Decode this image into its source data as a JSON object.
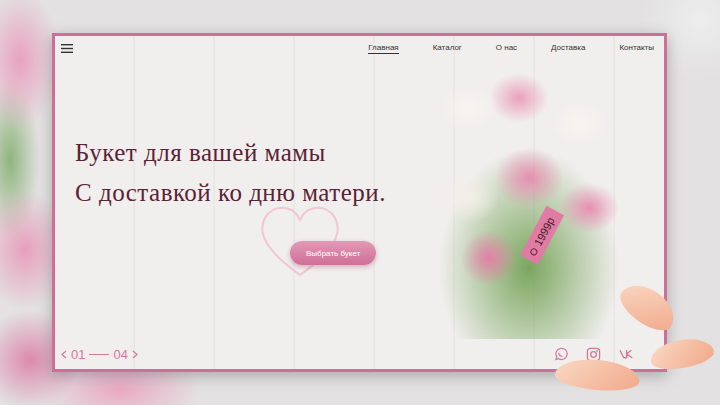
{
  "nav": [
    {
      "label": "Главная",
      "selected": true
    },
    {
      "label": "Каталог",
      "selected": false
    },
    {
      "label": "О нас",
      "selected": false
    },
    {
      "label": "Доставка",
      "selected": false
    },
    {
      "label": "Контакты",
      "selected": false
    }
  ],
  "hero": {
    "lines": [
      "Букет для вашей мамы",
      "С доставкой ко дню матери."
    ],
    "button": "Выбрать букет"
  },
  "price_tag": "1999р",
  "pagination": {
    "current": "01",
    "total": "04"
  }
}
